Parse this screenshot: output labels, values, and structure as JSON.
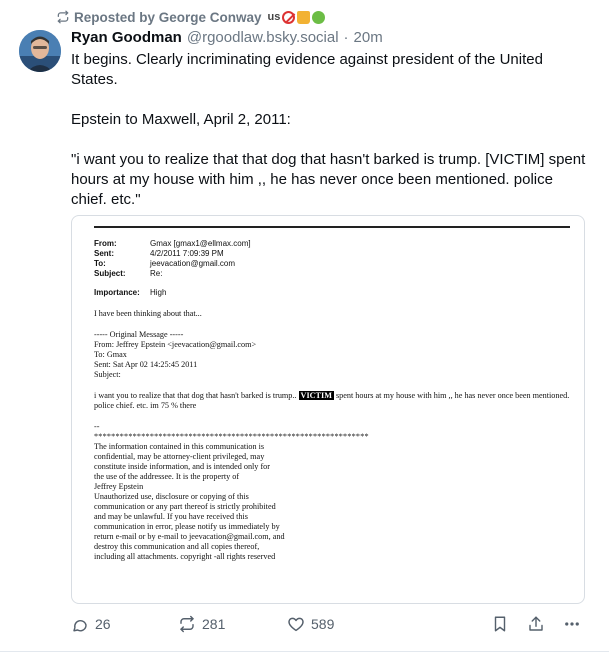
{
  "repost": {
    "label": "Reposted by George Conway",
    "flair": "us"
  },
  "author": {
    "display_name": "Ryan Goodman",
    "handle": "@rgoodlaw.bsky.social",
    "separator": "·",
    "time": "20m"
  },
  "post": {
    "paragraphs": [
      "It begins. Clearly incriminating evidence against president of the United States.",
      "Epstein to Maxwell, April 2, 2011:",
      "\"i want you to realize that that dog that hasn't barked is trump. [VICTIM] spent hours at my house with him ,, he has never once been mentioned. police chief. etc.\""
    ]
  },
  "email": {
    "headers": [
      {
        "key": "From:",
        "value": "Gmax [gmax1@ellmax.com]"
      },
      {
        "key": "Sent:",
        "value": "4/2/2011 7:09:39 PM"
      },
      {
        "key": "To:",
        "value": "jeevacation@gmail.com"
      },
      {
        "key": "Subject:",
        "value": "Re:"
      }
    ],
    "importance": {
      "key": "Importance:",
      "value": "High"
    },
    "reply": "I have been thinking about that...",
    "original": [
      "----- Original Message -----",
      "From: Jeffrey Epstein <jeevacation@gmail.com>",
      "To: Gmax",
      "Sent: Sat Apr 02 14:25:45 2011",
      "Subject:"
    ],
    "message_before": "i want you to realize that that dog that hasn't barked is trump..",
    "redaction": "VICTIM",
    "message_after": "spent hours at my house with him ,, he has never once been mentioned.  police chief. etc.  im 75 % there",
    "sig_dash": "--",
    "stars": "****************************************************************",
    "disclaimer": [
      "The information contained in this communication is",
      "confidential, may be attorney-client privileged, may",
      "constitute inside information, and is intended only for",
      "the use of the addressee. It is the property of",
      "Jeffrey Epstein",
      "Unauthorized use, disclosure or copying of this",
      "communication or any part thereof is strictly prohibited",
      "and may be unlawful. If you have received this",
      "communication in error, please notify us immediately by",
      "return e-mail or by e-mail to jeevacation@gmail.com, and",
      "destroy this communication and all copies thereof,",
      "including all attachments. copyright -all rights reserved"
    ]
  },
  "actions": {
    "replies": "26",
    "reposts": "281",
    "likes": "589"
  },
  "colors": {
    "muted": "#6b7783",
    "border": "#d8dde3",
    "text": "#0b0f14"
  }
}
